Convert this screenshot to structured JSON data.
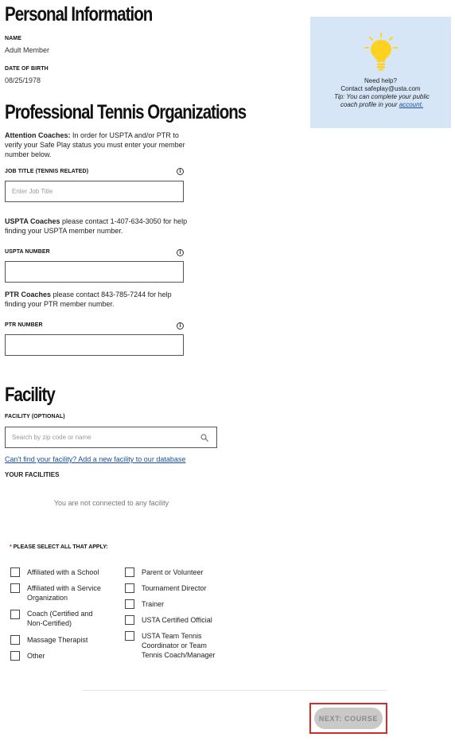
{
  "personal": {
    "heading": "Personal Information",
    "name_label": "NAME",
    "name_value": "Adult Member",
    "dob_label": "DATE OF BIRTH",
    "dob_value": "08/25/1978"
  },
  "help": {
    "title": "Need help?",
    "contact": "Contact safeplay@usta.com",
    "tip_prefix": "Tip: You can complete your public coach profile in your ",
    "tip_link": "account."
  },
  "professional": {
    "heading": "Professional Tennis Organizations",
    "attention_bold": "Attention Coaches:",
    "attention_text": " In order for USPTA and/or PTR to verify your Safe Play status you must enter your member number below.",
    "job_title_label": "JOB TITLE (TENNIS RELATED)",
    "job_title_placeholder": "Enter Job Title",
    "uspta_bold": "USPTA Coaches",
    "uspta_text": " please contact 1-407-634-3050 for help finding your USPTA member number.",
    "uspta_label": "USPTA NUMBER",
    "uspta_value": "",
    "ptr_bold": "PTR Coaches",
    "ptr_text": " please contact 843-785-7244 for help finding your PTR member number.",
    "ptr_label": "PTR NUMBER",
    "ptr_value": "",
    "info_glyph": "i"
  },
  "facility": {
    "heading": "Facility",
    "label": "FACILITY (OPTIONAL)",
    "search_placeholder": "Search by zip code or name",
    "add_link": "Can't find your facility? Add a new facility to our database",
    "your_facilities": "YOUR FACILITIES",
    "empty_message": "You are not connected to any facility"
  },
  "roles": {
    "required_marker": "*",
    "label": "PLEASE SELECT ALL THAT APPLY:",
    "left": [
      "Affiliated with a School",
      "Affiliated with a Service Organization",
      "Coach (Certified and Non-Certified)",
      "Massage Therapist",
      "Other"
    ],
    "right": [
      "Parent or Volunteer",
      "Tournament Director",
      "Trainer",
      "USTA Certified Official",
      "USTA Team Tennis Coordinator or Team Tennis Coach/Manager"
    ]
  },
  "footer": {
    "next_label": "NEXT: COURSE"
  },
  "colors": {
    "help_bg": "#d6e6f7",
    "bulb": "#ffd21f",
    "link": "#1a4fa0",
    "required": "#d52b2b",
    "highlight": "#d52b2b"
  },
  "icons": {
    "help": "lightbulb-icon",
    "info": "info-icon",
    "search": "search-icon"
  }
}
